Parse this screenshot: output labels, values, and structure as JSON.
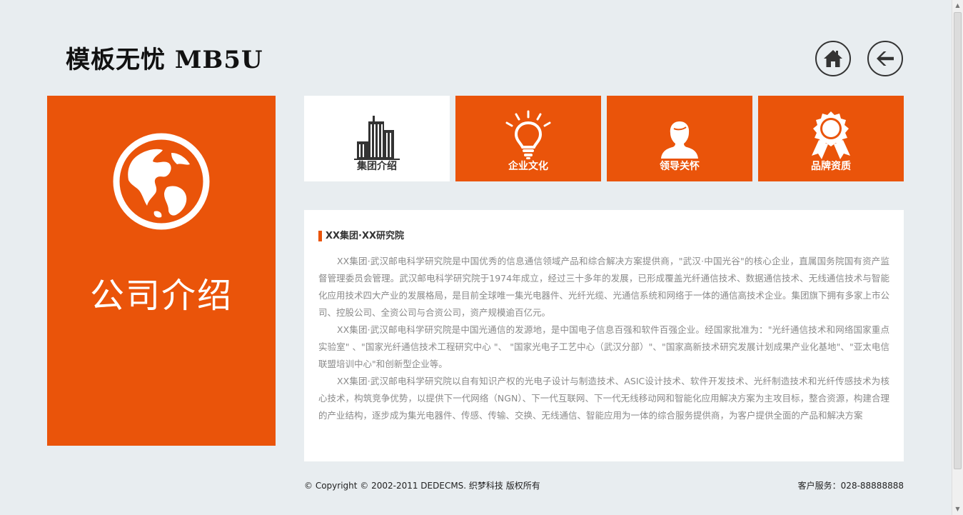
{
  "header": {
    "site_title": "模板无忧 MB5U",
    "home_icon": "home-icon",
    "back_icon": "arrow-left-icon"
  },
  "side_panel": {
    "icon": "globe-icon",
    "title": "公司介绍"
  },
  "tiles": [
    {
      "label": "集团介绍",
      "icon": "building-icon",
      "active": true
    },
    {
      "label": "企业文化",
      "icon": "lightbulb-icon",
      "active": false
    },
    {
      "label": "领导关怀",
      "icon": "person-icon",
      "active": false
    },
    {
      "label": "品牌资质",
      "icon": "award-ribbon-icon",
      "active": false
    }
  ],
  "content": {
    "heading": "XX集团·XX研究院",
    "paragraphs": [
      "XX集团·武汉邮电科学研究院是中国优秀的信息通信领域产品和综合解决方案提供商，\"武汉·中国光谷\"的核心企业，直属国务院国有资产监督管理委员会管理。武汉邮电科学研究院于1974年成立，经过三十多年的发展，已形成覆盖光纤通信技术、数据通信技术、无线通信技术与智能化应用技术四大产业的发展格局，是目前全球唯一集光电器件、光纤光缆、光通信系统和网络于一体的通信高技术企业。集团旗下拥有多家上市公司、控股公司、全资公司与合资公司，资产规模逾百亿元。",
      "XX集团·武汉邮电科学研究院是中国光通信的发源地，是中国电子信息百强和软件百强企业。经国家批准为：\"光纤通信技术和网络国家重点实验室\" 、\"国家光纤通信技术工程研究中心 \"、 \"国家光电子工艺中心（武汉分部）\"、\"国家高新技术研究发展计划成果产业化基地\"、\"亚太电信联盟培训中心\"和创新型企业等。",
      "XX集团·武汉邮电科学研究院以自有知识产权的光电子设计与制造技术、ASIC设计技术、软件开发技术、光纤制造技术和光纤传感技术为核心技术，构筑竞争优势，以提供下一代网络（NGN）、下一代互联网、下一代无线移动网和智能化应用解决方案为主攻目标，整合资源，构建合理的产业结构，逐步成为集光电器件、传感、传输、交换、无线通信、智能应用为一体的综合服务提供商，为客户提供全面的产品和解决方案"
    ]
  },
  "footer": {
    "copyright": "© Copyright © 2002-2011 DEDECMS. 织梦科技 版权所有",
    "service": "客户服务：028-88888888"
  },
  "colors": {
    "accent": "#ea540a",
    "background": "#e8edf0",
    "tile_active_bg": "#ffffff",
    "heading_text": "#111111",
    "body_text": "#8a8a8a"
  }
}
